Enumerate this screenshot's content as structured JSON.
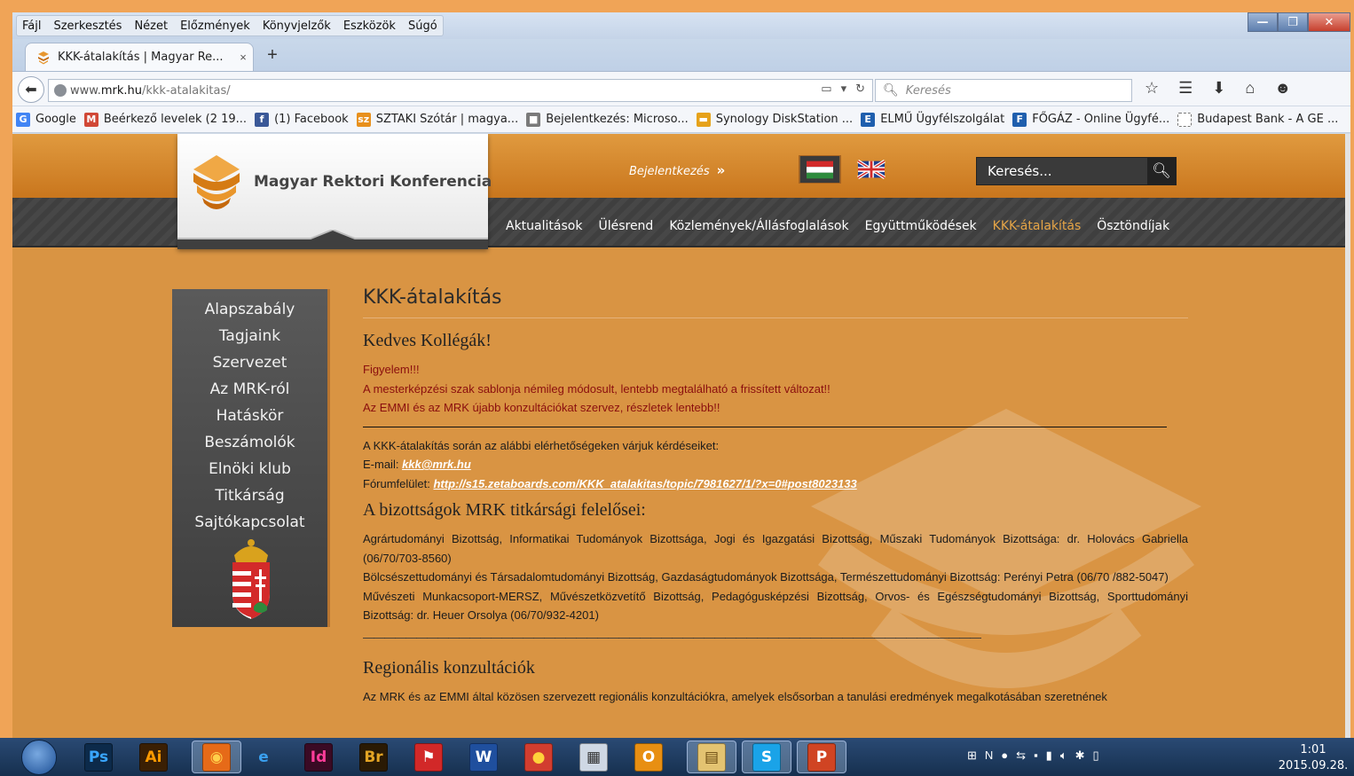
{
  "window": {
    "menu": [
      "Fájl",
      "Szerkesztés",
      "Nézet",
      "Előzmények",
      "Könyvjelzők",
      "Eszközök",
      "Súgó"
    ],
    "tab_title": "KKK-átalakítás | Magyar Re...",
    "tab_close": "×",
    "new_tab": "+",
    "url_host_prefix": "www.",
    "url_host": "mrk.hu",
    "url_path": "/kkk-atalakitas/",
    "search_placeholder": "Keresés",
    "bookmarks": [
      {
        "label": "Google",
        "icon": "google-icon",
        "color": "#4285f4",
        "glyph": "G"
      },
      {
        "label": "Beérkező levelek (2 19...",
        "icon": "gmail-icon",
        "color": "#d14836",
        "glyph": "M"
      },
      {
        "label": "(1) Facebook",
        "icon": "facebook-icon",
        "color": "#3b5998",
        "glyph": "f"
      },
      {
        "label": "SZTAKI Szótár | magya...",
        "icon": "sztaki-icon",
        "color": "#e8901c",
        "glyph": "sz"
      },
      {
        "label": "Bejelentkezés: Microso...",
        "icon": "microsoft-icon",
        "color": "#7a7a7a",
        "glyph": "■"
      },
      {
        "label": "Synology DiskStation ...",
        "icon": "synology-icon",
        "color": "#e6a21a",
        "glyph": "▬"
      },
      {
        "label": "ELMŰ Ügyfélszolgálat",
        "icon": "elmu-icon",
        "color": "#1f5fae",
        "glyph": "E"
      },
      {
        "label": "FŐGÁZ - Online Ügyfé...",
        "icon": "fogaz-icon",
        "color": "#1f5fae",
        "glyph": "F"
      },
      {
        "label": "Budapest Bank - A GE ...",
        "icon": "page-icon",
        "color": "#ffffff",
        "glyph": ""
      }
    ]
  },
  "site": {
    "name": "Magyar Rektori Konferencia",
    "login": "Bejelentkezés",
    "search_placeholder": "Keresés...",
    "nav": [
      "Aktualitások",
      "Ülésrend",
      "Közlemények/Állásfoglalások",
      "Együttműködések",
      "KKK-átalakítás",
      "Ösztöndíjak"
    ],
    "nav_active": "KKK-átalakítás",
    "sidebar": [
      "Alapszabály",
      "Tagjaink",
      "Szervezet",
      "Az MRK-ról",
      "Hatáskör",
      "Beszámolók",
      "Elnöki klub",
      "Titkárság",
      "Sajtókapcsolat"
    ]
  },
  "content": {
    "title": "KKK-átalakítás",
    "greeting": "Kedves Kollégák!",
    "notice_1": "Figyelem!!!",
    "notice_2": "A mesterképzési szak sablonja némileg módosult, lentebb megtalálható a frissített változat!!",
    "notice_3": "Az EMMI és az MRK újabb konzultációkat szervez, részletek lentebb!!",
    "contact_intro": "A KKK-átalakítás során az alábbi elérhetőségeken várjuk kérdéseiket:",
    "email_label": "E-mail: ",
    "email": "kkk@mrk.hu",
    "forum_label": "Fórumfelület: ",
    "forum_link": "http://s15.zetaboards.com/KKK_atalakitas/topic/7981627/1/?x=0#post8023133",
    "committees_heading": "A bizottságok MRK titkársági felelősei:",
    "committees_1": "Agrártudományi Bizottság, Informatikai Tudományok Bizottsága, Jogi és Igazgatási Bizottság, Műszaki Tudományok Bizottsága: dr. Holovács Gabriella (06/70/703-8560)",
    "committees_2": "Bölcsészettudományi és Társadalomtudományi Bizottság, Gazdaságtudományok Bizottsága, Természettudományi Bizottság: Perényi Petra (06/70 /882-5047)",
    "committees_3": "Művészeti Munkacsoport-MERSZ, Művészetközvetítő Bizottság, Pedagógusképzési Bizottság, Orvos- és Egészségtudományi Bizottság, Sporttudományi Bizottság: dr. Heuer Orsolya (06/70/932-4201)",
    "dashes": "——————————————————————————————————————————————————————————",
    "regional_heading": "Regionális konzultációk",
    "regional_text": "Az MRK és az EMMI által közösen szervezett regionális konzultációkra, amelyek elsősorban a tanulási eredmények megalkotásában szeretnének"
  },
  "taskbar": {
    "apps": [
      {
        "name": "photoshop-icon",
        "glyph": "Ps",
        "bg": "#0c2a4a",
        "fg": "#39a6ff",
        "active": false
      },
      {
        "name": "illustrator-icon",
        "glyph": "Ai",
        "bg": "#3a1f04",
        "fg": "#ff9a00",
        "active": false
      },
      {
        "name": "firefox-icon",
        "glyph": "◉",
        "bg": "#e66a18",
        "fg": "#ffd04a",
        "active": true
      },
      {
        "name": "ie-icon",
        "glyph": "e",
        "bg": "transparent",
        "fg": "#3aa0f0",
        "active": false
      },
      {
        "name": "indesign-icon",
        "glyph": "Id",
        "bg": "#3a0a24",
        "fg": "#ff3d9a",
        "active": false
      },
      {
        "name": "bridge-icon",
        "glyph": "Br",
        "bg": "#2a1a04",
        "fg": "#e3a424",
        "active": false
      },
      {
        "name": "app-red-icon",
        "glyph": "⚑",
        "bg": "#d22828",
        "fg": "#ffffff",
        "active": false
      },
      {
        "name": "word-icon",
        "glyph": "W",
        "bg": "#1f4f9e",
        "fg": "#ffffff",
        "active": false
      },
      {
        "name": "chrome-icon",
        "glyph": "●",
        "bg": "#d23d2f",
        "fg": "#ffd23a",
        "active": false
      },
      {
        "name": "calculator-icon",
        "glyph": "▦",
        "bg": "#cfd8e4",
        "fg": "#333333",
        "active": false
      },
      {
        "name": "outlook-icon",
        "glyph": "O",
        "bg": "#e88f12",
        "fg": "#ffffff",
        "active": false
      },
      {
        "name": "explorer-icon",
        "glyph": "▤",
        "bg": "#e3c371",
        "fg": "#6a4a10",
        "active": true
      },
      {
        "name": "skype-icon",
        "glyph": "S",
        "bg": "#1aa3e8",
        "fg": "#ffffff",
        "active": true
      },
      {
        "name": "powerpoint-icon",
        "glyph": "P",
        "bg": "#d04423",
        "fg": "#ffffff",
        "active": true
      }
    ],
    "time": "1:01",
    "date": "2015.09.28."
  }
}
